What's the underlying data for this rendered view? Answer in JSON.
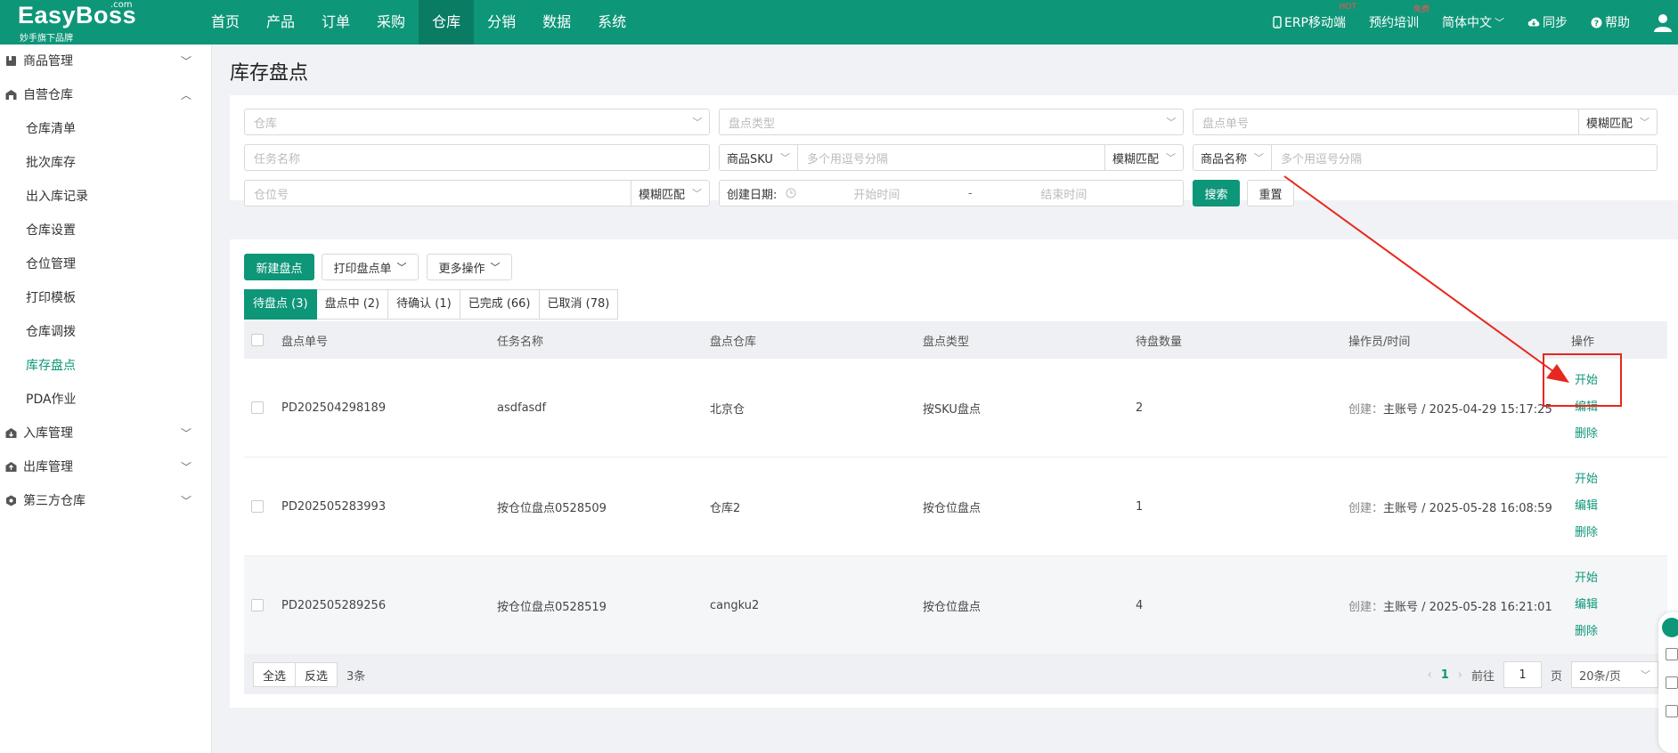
{
  "topbar": {
    "brand": "EasyBoss",
    "brand_dotcom": ".com",
    "brand_sub": "妙手旗下品牌",
    "nav": [
      "首页",
      "产品",
      "订单",
      "采购",
      "仓库",
      "分销",
      "数据",
      "系统"
    ],
    "right": {
      "erp_mobile": "ERP移动端",
      "erp_badge": "HOT",
      "training": "预约培训",
      "training_badge": "免费",
      "language": "简体中文",
      "sync": "同步",
      "help": "帮助"
    }
  },
  "sidebar": {
    "groups": [
      {
        "label": "商品管理",
        "icon": "product-icon",
        "expanded": false
      },
      {
        "label": "自营仓库",
        "icon": "warehouse-icon",
        "expanded": true,
        "items": [
          "仓库清单",
          "批次库存",
          "出入库记录",
          "仓库设置",
          "仓位管理",
          "打印模板",
          "仓库调拨",
          "库存盘点",
          "PDA作业"
        ]
      },
      {
        "label": "入库管理",
        "icon": "inbound-icon",
        "expanded": false
      },
      {
        "label": "出库管理",
        "icon": "outbound-icon",
        "expanded": false
      },
      {
        "label": "第三方仓库",
        "icon": "third-party-icon",
        "expanded": false
      }
    ],
    "active_item": "库存盘点"
  },
  "page": {
    "title": "库存盘点"
  },
  "filters": {
    "warehouse_ph": "仓库",
    "type_ph": "盘点类型",
    "order_no_ph": "盘点单号",
    "match_mode": "模糊匹配",
    "task_name_ph": "任务名称",
    "sku_select": "商品SKU",
    "multi_ph": "多个用逗号分隔",
    "product_name_select": "商品名称",
    "location_ph": "仓位号",
    "date_label": "创建日期:",
    "start_ph": "开始时间",
    "date_sep": "-",
    "end_ph": "结束时间",
    "search_btn": "搜索",
    "reset_btn": "重置"
  },
  "toolbar": {
    "new_btn": "新建盘点",
    "print_btn": "打印盘点单",
    "more_btn": "更多操作"
  },
  "tabs": [
    "待盘点 (3)",
    "盘点中 (2)",
    "待确认 (1)",
    "已完成 (66)",
    "已取消 (78)"
  ],
  "table": {
    "headers": [
      "盘点单号",
      "任务名称",
      "盘点仓库",
      "盘点类型",
      "待盘数量",
      "操作员/时间",
      "操作"
    ],
    "created_label": "创建：",
    "ops": [
      "开始",
      "编辑",
      "删除"
    ],
    "rows": [
      {
        "no": "PD202504298189",
        "task": "asdfasdf",
        "warehouse": "北京仓",
        "type": "按SKU盘点",
        "qty": "2",
        "operator": "主账号 / 2025-04-29 15:17:25"
      },
      {
        "no": "PD202505283993",
        "task": "按仓位盘点0528509",
        "warehouse": "仓库2",
        "type": "按仓位盘点",
        "qty": "1",
        "operator": "主账号 / 2025-05-28 16:08:59"
      },
      {
        "no": "PD202505289256",
        "task": "按仓位盘点0528519",
        "warehouse": "cangku2",
        "type": "按仓位盘点",
        "qty": "4",
        "operator": "主账号 / 2025-05-28 16:21:01"
      }
    ]
  },
  "footer": {
    "select_all": "全选",
    "invert": "反选",
    "count": "3条",
    "current_page": "1",
    "goto_label": "前往",
    "goto_value": "1",
    "page_unit": "页",
    "page_size": "20条/页"
  },
  "colors": {
    "primary": "#0e9679",
    "annotation": "#e8271e"
  }
}
